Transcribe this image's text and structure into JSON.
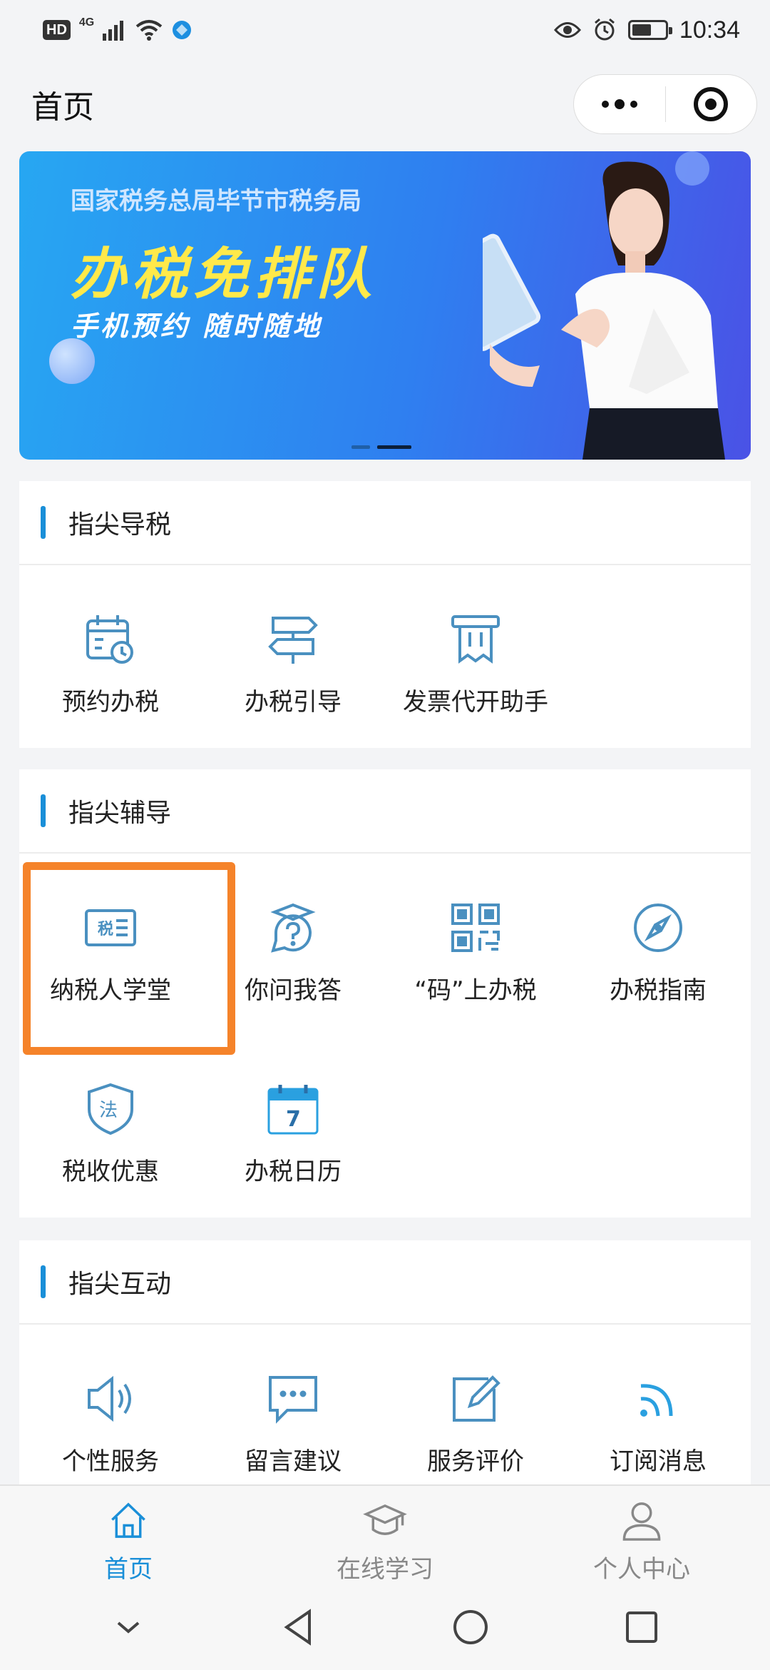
{
  "status_bar": {
    "hd": "HD",
    "network": "4G",
    "time": "10:34"
  },
  "header": {
    "title": "首页"
  },
  "banner": {
    "org": "国家税务总局毕节市税务局",
    "headline": "办税免排队",
    "subline": "手机预约  随时随地"
  },
  "sections": [
    {
      "title": "指尖导税",
      "items": [
        {
          "label": "预约办税",
          "icon": "calendar-clock-icon"
        },
        {
          "label": "办税引导",
          "icon": "signpost-icon"
        },
        {
          "label": "发票代开助手",
          "icon": "receipt-icon"
        }
      ]
    },
    {
      "title": "指尖辅导",
      "items": [
        {
          "label": "纳税人学堂",
          "icon": "tax-classroom-icon"
        },
        {
          "label": "你问我答",
          "icon": "question-chat-icon"
        },
        {
          "label": "“码”上办税",
          "icon": "qr-code-icon"
        },
        {
          "label": "办税指南",
          "icon": "compass-icon"
        },
        {
          "label": "税收优惠",
          "icon": "law-shield-icon"
        },
        {
          "label": "办税日历",
          "icon": "calendar-icon"
        }
      ]
    },
    {
      "title": "指尖互动",
      "items": [
        {
          "label": "个性服务",
          "icon": "speaker-icon"
        },
        {
          "label": "留言建议",
          "icon": "message-icon"
        },
        {
          "label": "服务评价",
          "icon": "edit-icon"
        },
        {
          "label": "订阅消息",
          "icon": "rss-icon"
        }
      ]
    }
  ],
  "icon_glyphs": {
    "tax": "税",
    "law": "法",
    "calendar_day": "7"
  },
  "tabbar": [
    {
      "label": "首页",
      "icon": "home-icon",
      "active": true
    },
    {
      "label": "在线学习",
      "icon": "graduation-cap-icon",
      "active": false
    },
    {
      "label": "个人中心",
      "icon": "user-icon",
      "active": false
    }
  ],
  "colors": {
    "accent": "#1a8fd8",
    "icon": "#4a90c0",
    "highlight": "#f5832a",
    "tab_inactive": "#888888"
  }
}
